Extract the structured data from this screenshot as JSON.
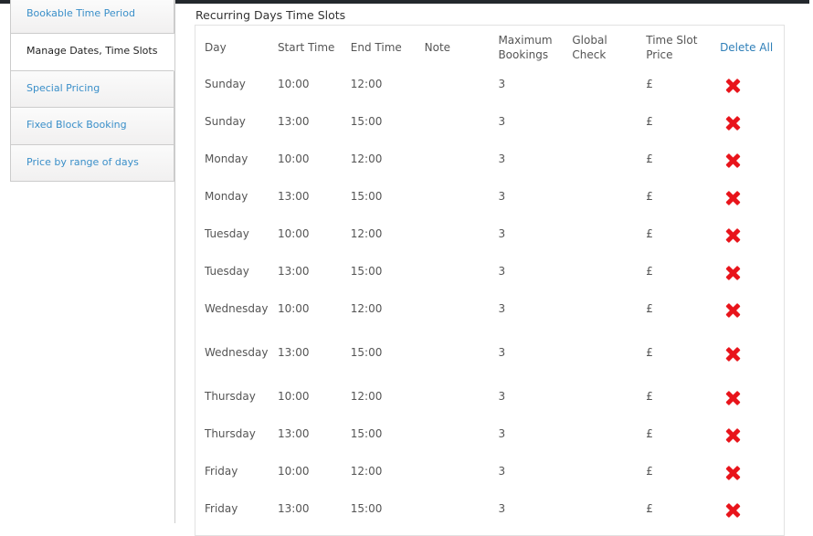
{
  "sidebar": {
    "items": [
      {
        "label": "Bookable Time Period",
        "active": false
      },
      {
        "label": "Manage Dates, Time Slots",
        "active": true
      },
      {
        "label": "Special Pricing",
        "active": false
      },
      {
        "label": "Fixed Block Booking",
        "active": false
      },
      {
        "label": "Price by range of days",
        "active": false
      }
    ]
  },
  "section": {
    "title": "Recurring Days Time Slots"
  },
  "table": {
    "headers": {
      "day": "Day",
      "start": "Start Time",
      "end": "End Time",
      "note": "Note",
      "max_line1": "Maximum",
      "max_line2": "Bookings",
      "global_line1": "Global",
      "global_line2": "Check",
      "price_line1": "Time Slot",
      "price_line2": "Price",
      "delete_all": "Delete All"
    },
    "rows": [
      {
        "day": "Sunday",
        "start": "10:00",
        "end": "12:00",
        "note": "",
        "max": "3",
        "global": "",
        "price": "£"
      },
      {
        "day": "Sunday",
        "start": "13:00",
        "end": "15:00",
        "note": "",
        "max": "3",
        "global": "",
        "price": "£"
      },
      {
        "day": "Monday",
        "start": "10:00",
        "end": "12:00",
        "note": "",
        "max": "3",
        "global": "",
        "price": "£"
      },
      {
        "day": "Monday",
        "start": "13:00",
        "end": "15:00",
        "note": "",
        "max": "3",
        "global": "",
        "price": "£"
      },
      {
        "day": "Tuesday",
        "start": "10:00",
        "end": "12:00",
        "note": "",
        "max": "3",
        "global": "",
        "price": "£"
      },
      {
        "day": "Tuesday",
        "start": "13:00",
        "end": "15:00",
        "note": "",
        "max": "3",
        "global": "",
        "price": "£"
      },
      {
        "day": "Wednesday",
        "start": "10:00",
        "end": "12:00",
        "note": "",
        "max": "3",
        "global": "",
        "price": "£"
      },
      {
        "day": "Wednesday",
        "start": "13:00",
        "end": "15:00",
        "note": "",
        "max": "3",
        "global": "",
        "price": "£"
      },
      {
        "day": "Thursday",
        "start": "10:00",
        "end": "12:00",
        "note": "",
        "max": "3",
        "global": "",
        "price": "£"
      },
      {
        "day": "Thursday",
        "start": "13:00",
        "end": "15:00",
        "note": "",
        "max": "3",
        "global": "",
        "price": "£"
      },
      {
        "day": "Friday",
        "start": "10:00",
        "end": "12:00",
        "note": "",
        "max": "3",
        "global": "",
        "price": "£"
      },
      {
        "day": "Friday",
        "start": "13:00",
        "end": "15:00",
        "note": "",
        "max": "3",
        "global": "",
        "price": "£"
      }
    ],
    "delete_icon": "delete-x-icon"
  },
  "colors": {
    "link": "#3a8fc9",
    "delete": "#e8141b",
    "topbar": "#23282d"
  }
}
